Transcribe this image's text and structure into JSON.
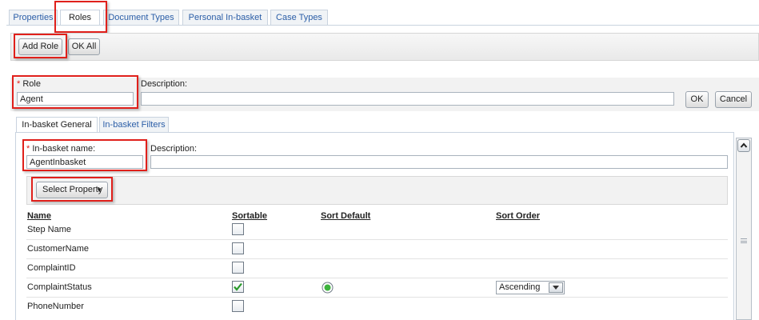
{
  "tabs": [
    "Properties",
    "Roles",
    "Document Types",
    "Personal In-basket",
    "Case Types"
  ],
  "toolbar": {
    "add_role": "Add Role",
    "ok_all": "OK All"
  },
  "role": {
    "required_mark": "*",
    "label": "Role",
    "value": "Agent",
    "description_label": "Description:",
    "description_value": "",
    "ok": "OK",
    "cancel": "Cancel"
  },
  "subtabs": [
    "In-basket General",
    "In-basket Filters"
  ],
  "inbasket": {
    "required_mark": "*",
    "name_label": "In-basket name:",
    "name_value": "AgentInbasket",
    "description_label": "Description:",
    "description_value": "",
    "select_property": "Select Property"
  },
  "columns": {
    "name": "Name",
    "sortable": "Sortable",
    "sort_default": "Sort Default",
    "sort_order": "Sort Order"
  },
  "rows": [
    {
      "name": "Step Name",
      "sortable": false
    },
    {
      "name": "CustomerName",
      "sortable": false
    },
    {
      "name": "ComplaintID",
      "sortable": false
    },
    {
      "name": "ComplaintStatus",
      "sortable": true,
      "sort_default": true,
      "sort_order": "Ascending"
    },
    {
      "name": "PhoneNumber",
      "sortable": false
    }
  ],
  "icons": {
    "dropdown": "chevron-down-icon",
    "scroll_up": "chevron-up-icon",
    "scroll_grip": "grip-icon",
    "check": "check-icon",
    "radio": "radio-selected-icon"
  },
  "colors": {
    "highlight": "#e0201b",
    "link_tab": "#2b5ea7",
    "check": "#2a9a2a",
    "radio": "#3db33d"
  }
}
